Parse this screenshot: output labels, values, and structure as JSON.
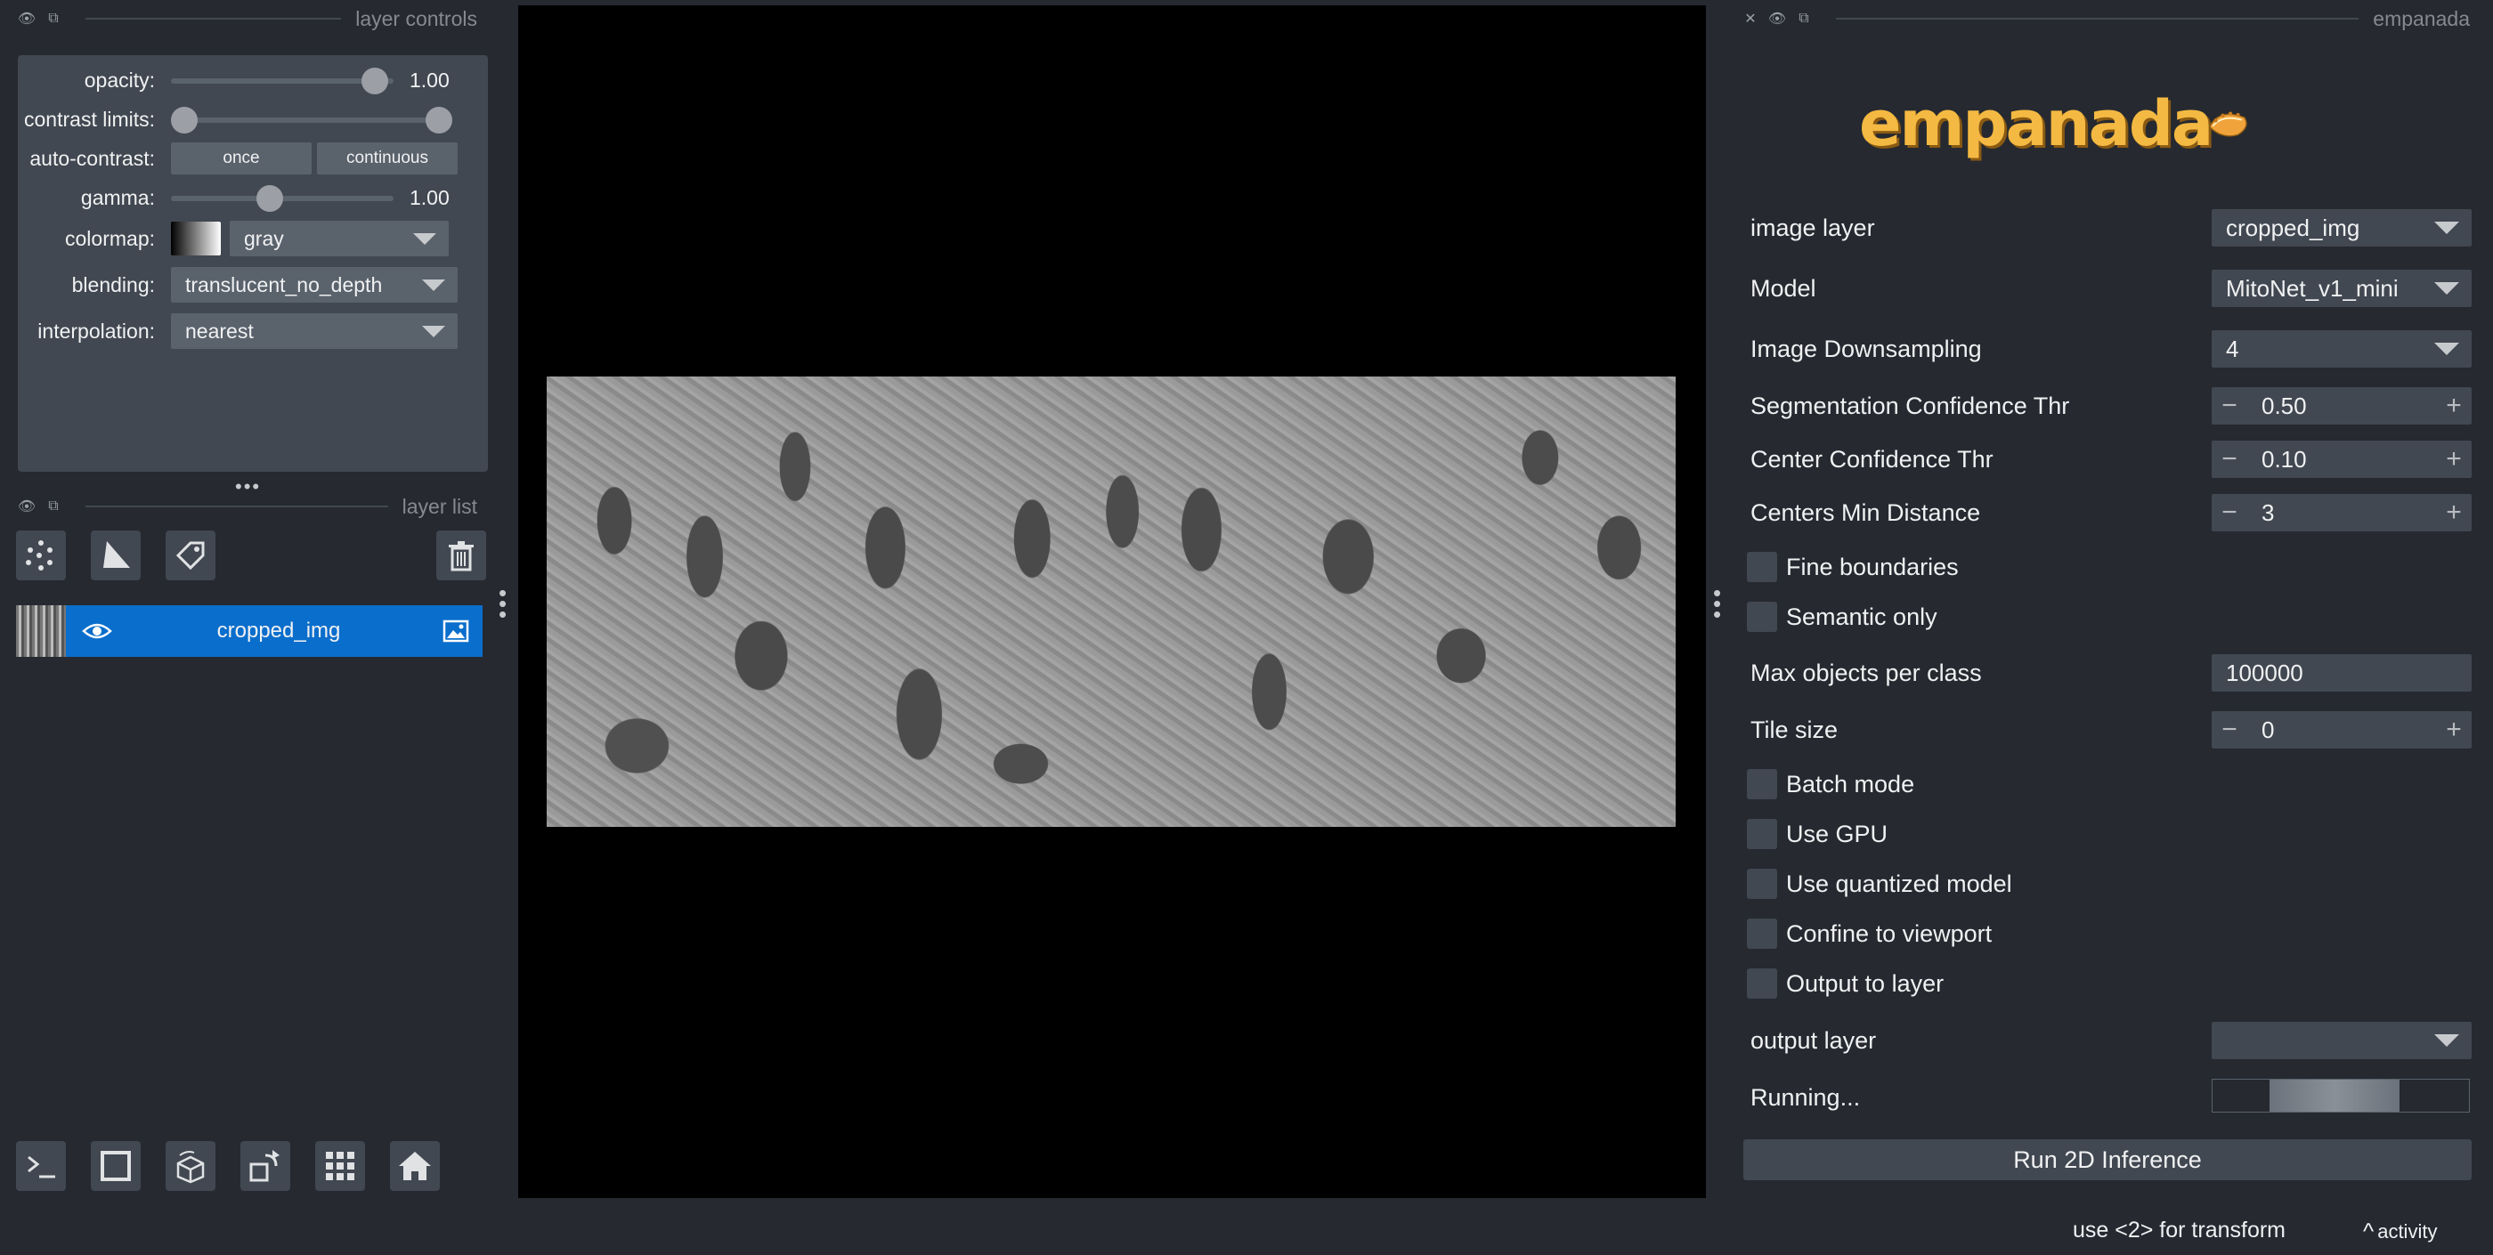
{
  "left_dock": {
    "layer_controls_title": "layer controls",
    "layer_list_title": "layer list"
  },
  "controls": {
    "opacity": {
      "label": "opacity:",
      "value": "1.00",
      "fraction": 1.0
    },
    "contrast_limits": {
      "label": "contrast limits:",
      "low": 0.0,
      "high": 1.0
    },
    "auto_contrast": {
      "label": "auto-contrast:",
      "once": "once",
      "continuous": "continuous"
    },
    "gamma": {
      "label": "gamma:",
      "value": "1.00",
      "fraction": 0.45
    },
    "colormap": {
      "label": "colormap:",
      "value": "gray"
    },
    "blending": {
      "label": "blending:",
      "value": "translucent_no_depth"
    },
    "interpolation": {
      "label": "interpolation:",
      "value": "nearest"
    }
  },
  "layer_list": {
    "layers": [
      {
        "name": "cropped_img",
        "visible": true,
        "selected": true
      }
    ]
  },
  "empanada": {
    "panel_title": "empanada",
    "logo_text": "empanada",
    "image_layer": {
      "label": "image layer",
      "value": "cropped_img"
    },
    "model": {
      "label": "Model",
      "value": "MitoNet_v1_mini"
    },
    "downsampling": {
      "label": "Image Downsampling",
      "value": "4"
    },
    "seg_conf": {
      "label": "Segmentation Confidence Thr",
      "value": "0.50"
    },
    "center_conf": {
      "label": "Center Confidence Thr",
      "value": "0.10"
    },
    "centers_min": {
      "label": "Centers Min Distance",
      "value": "3"
    },
    "fine_boundaries": {
      "label": "Fine boundaries",
      "checked": false
    },
    "semantic_only": {
      "label": "Semantic only",
      "checked": false
    },
    "max_objects": {
      "label": "Max objects per class",
      "value": "100000"
    },
    "tile_size": {
      "label": "Tile size",
      "value": "0"
    },
    "batch_mode": {
      "label": "Batch mode",
      "checked": false
    },
    "use_gpu": {
      "label": "Use GPU",
      "checked": false
    },
    "use_quantized": {
      "label": "Use quantized model",
      "checked": false
    },
    "confine_viewport": {
      "label": "Confine to viewport",
      "checked": false
    },
    "output_to_layer": {
      "label": "Output to layer",
      "checked": false
    },
    "output_layer": {
      "label": "output layer",
      "value": ""
    },
    "running": {
      "label": "Running..."
    },
    "run_button": "Run 2D Inference"
  },
  "status_bar": {
    "hint": "use <2> for transform",
    "activity": "activity"
  },
  "colors": {
    "background": "#262930",
    "panel": "#414851",
    "selected_layer": "#0a6ecc",
    "canvas": "#000000"
  }
}
